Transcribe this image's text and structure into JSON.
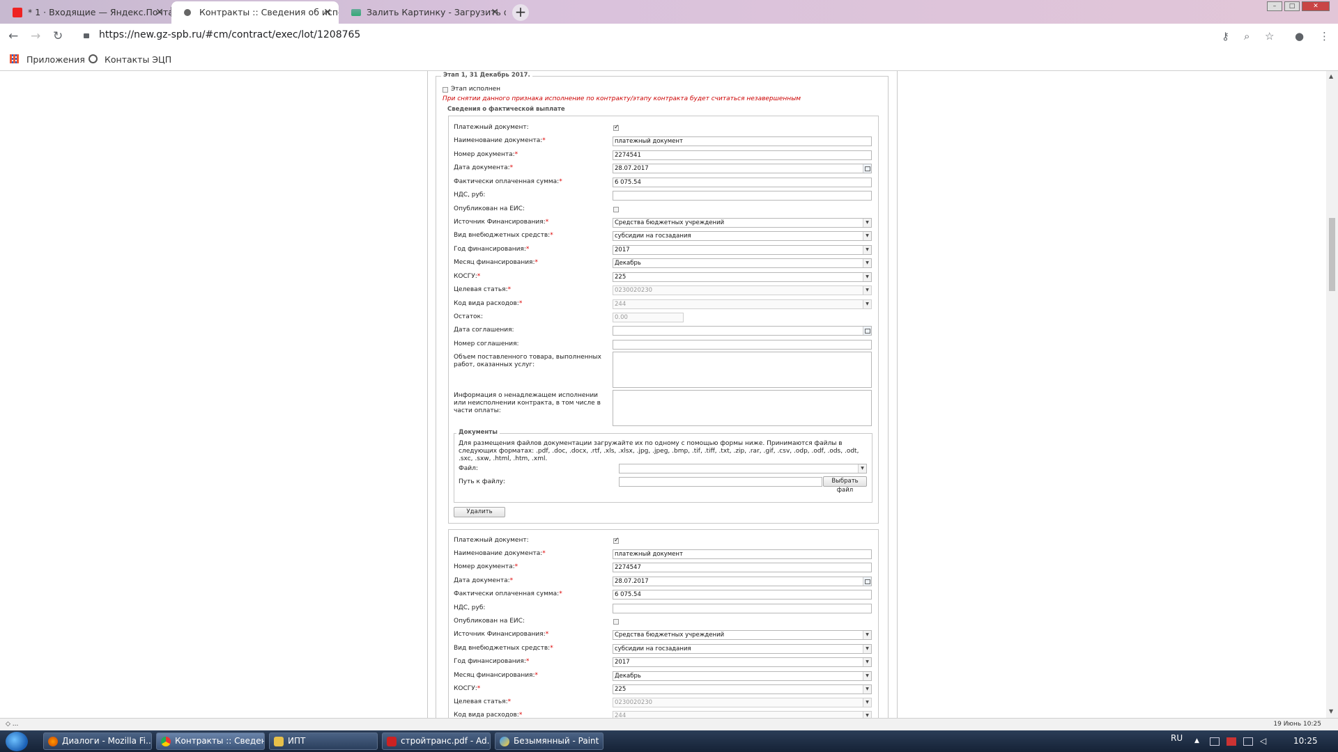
{
  "browser": {
    "tabs": [
      {
        "label": "* 1 · Входящие — Яндекс.Почта",
        "active": false
      },
      {
        "label": "Контракты :: Сведения об испол",
        "active": true
      },
      {
        "label": "Залить Картинку - Загрузить фо",
        "active": false
      }
    ],
    "new_tab": "+",
    "url": "https://new.gz-spb.ru/#cm/contract/exec/lot/1208765",
    "bookmarks": [
      "Приложения",
      "Контакты ЭЦП"
    ]
  },
  "stage": {
    "legend": "Этап 1, 31 Декабрь 2017.",
    "completed_label": "Этап исполнен",
    "warning": "При снятии данного признака исполнение по контракту/этапу контракта будет считаться незавершенным",
    "payment_legend": "Сведения о фактической выплате"
  },
  "labels": {
    "payment_doc": "Платежный документ:",
    "doc_name": "Наименование документа:",
    "doc_number": "Номер документа:",
    "doc_date": "Дата документа:",
    "paid_sum": "Фактически оплаченная сумма:",
    "vat": "НДС, руб:",
    "published": "Опубликован на ЕИС:",
    "fin_source": "Источник Финансирования:",
    "extra_funds": "Вид внебюджетных средств:",
    "fin_year": "Год финансирования:",
    "fin_month": "Месяц финансирования:",
    "kosgu": "КОСГУ:",
    "target_article": "Целевая статья:",
    "expense_code": "Код вида расходов:",
    "remainder": "Остаток:",
    "agreement_date": "Дата соглашения:",
    "agreement_number": "Номер соглашения:",
    "volume": "Объем поставленного товара, выполненных работ, оказанных услуг:",
    "improper_info": "Информация о ненадлежащем исполнении или неисполнении контракта, в том числе в части оплаты:",
    "req": "*"
  },
  "payments": [
    {
      "doc_name": "платежный документ",
      "doc_number": "2274541",
      "doc_date": "28.07.2017",
      "paid_sum": "6 075.54",
      "vat": "",
      "fin_source": "Средства бюджетных учреждений",
      "extra_funds": "субсидии на госзадания",
      "fin_year": "2017",
      "fin_month": "Декабрь",
      "kosgu": "225",
      "target_article": "0230020230",
      "expense_code": "244",
      "remainder": "0.00"
    },
    {
      "doc_name": "платежный документ",
      "doc_number": "2274547",
      "doc_date": "28.07.2017",
      "paid_sum": "6 075.54",
      "vat": "",
      "fin_source": "Средства бюджетных учреждений",
      "extra_funds": "субсидии на госзадания",
      "fin_year": "2017",
      "fin_month": "Декабрь",
      "kosgu": "225",
      "target_article": "0230020230",
      "expense_code": "244"
    }
  ],
  "documents": {
    "legend": "Документы",
    "info": "Для размещения файлов документации загружайте их по одному с помощью формы ниже. Принимаются файлы в следующих форматах: .pdf, .doc, .docx, .rtf, .xls, .xlsx, .jpg, .jpeg, .bmp, .tif, .tiff, .txt, .zip, .rar, .gif, .csv, .odp, .odf, .ods, .odt, .sxc, .sxw, .html, .htm, .xml.",
    "file_label": "Файл:",
    "path_label": "Путь к файлу:",
    "choose_button": "Выбрать файл",
    "delete_button": "Удалить"
  },
  "statusbar": {
    "left": "◇ ...",
    "right": "19 Июнь 10:25"
  },
  "taskbar": {
    "items": [
      {
        "label": "Диалоги - Mozilla Fi...",
        "active": false
      },
      {
        "label": "Контракты :: Сведен...",
        "active": true
      },
      {
        "label": "ИПТ",
        "active": false
      },
      {
        "label": "стройтранс.pdf - Ad...",
        "active": false
      },
      {
        "label": "Безымянный - Paint",
        "active": false
      }
    ],
    "lang": "RU",
    "time": "10:25"
  },
  "colors": {
    "required": "#dd0000",
    "warning": "#cc0000",
    "taskbar": "#1d2d45"
  }
}
